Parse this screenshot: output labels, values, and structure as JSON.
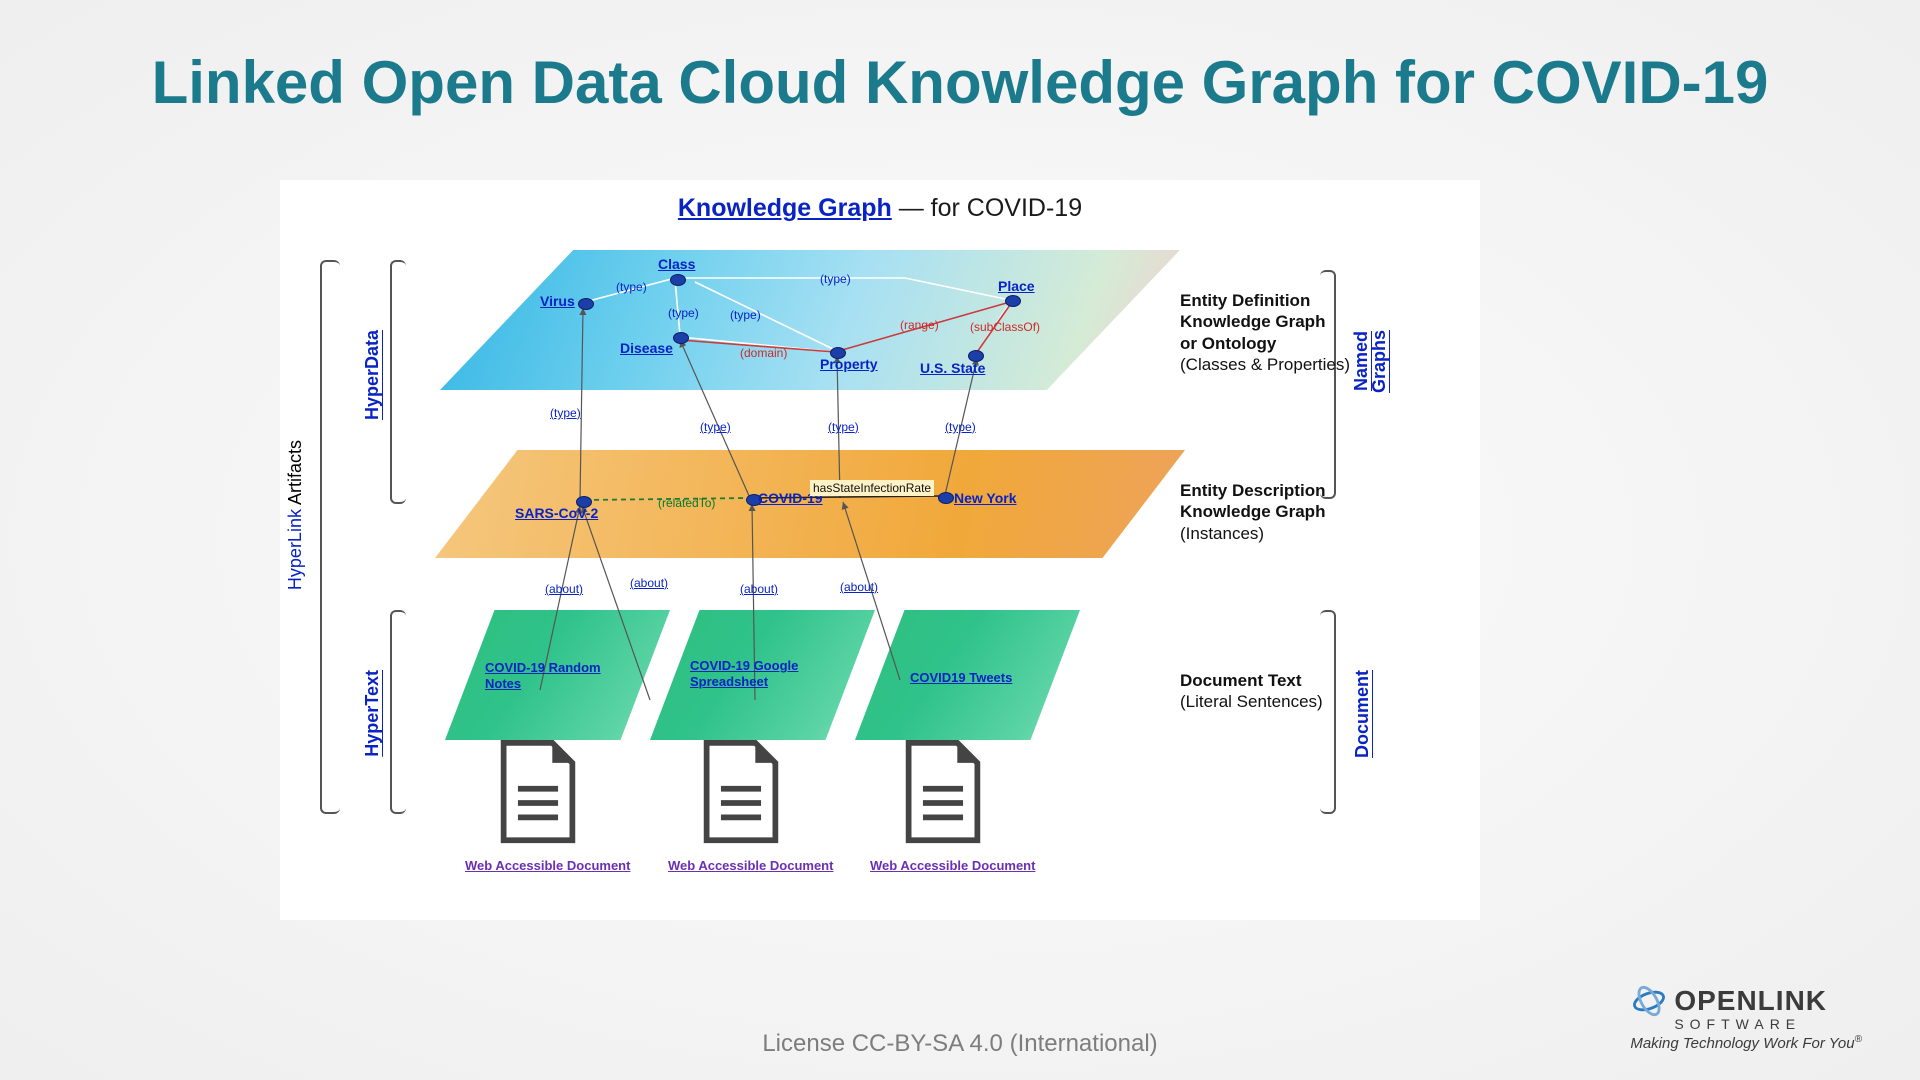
{
  "title": "Linked Open Data Cloud Knowledge Graph for COVID-19",
  "license": "License CC-BY-SA 4.0 (International)",
  "brand": {
    "name": "OPENLINK",
    "sub": "SOFTWARE",
    "tag": "Making Technology Work For You",
    "reg": "®"
  },
  "diagram": {
    "title": {
      "kg": "Knowledge Graph",
      "suffix": " — for COVID-19"
    },
    "leftAxis": {
      "link": "HyperLink",
      "plain": " Artifacts"
    },
    "leftAxisUpper": "HyperData",
    "leftAxisLower": "HyperText",
    "rightAxisTop1": "Named",
    "rightAxisTop2": "Graphs",
    "rightAxisBottom": "Document",
    "descTop": {
      "b1": "Entity Definition",
      "b2": "Knowledge Graph",
      "b3": "or Ontology",
      "p": "(Classes & Properties)"
    },
    "descMid": {
      "b1": "Entity Description",
      "b2": "Knowledge Graph",
      "p": "(Instances)"
    },
    "descBot": {
      "b1": "Document Text",
      "p": "(Literal Sentences)"
    },
    "topNodes": {
      "virus": "Virus",
      "class": "Class",
      "disease": "Disease",
      "property": "Property",
      "place": "Place",
      "usstate": "U.S. State"
    },
    "topEdges": {
      "type": "type",
      "domain": "domain",
      "range": "range",
      "subClassOf": "subClassOf"
    },
    "midNodes": {
      "sars": "SARS-CoV-2",
      "covid": "COVID-19",
      "ny": "New York"
    },
    "midEdges": {
      "relatedTo": "relatedTo",
      "hasState": "hasStateInfectionRate"
    },
    "interEdges": {
      "type": "type",
      "about": "about"
    },
    "greens": {
      "g1": "COVID-19 Random Notes",
      "g2": "COVID-19 Google Spreadsheet",
      "g3": "COVID19 Tweets"
    },
    "docLabel": "Web Accessible Document"
  }
}
